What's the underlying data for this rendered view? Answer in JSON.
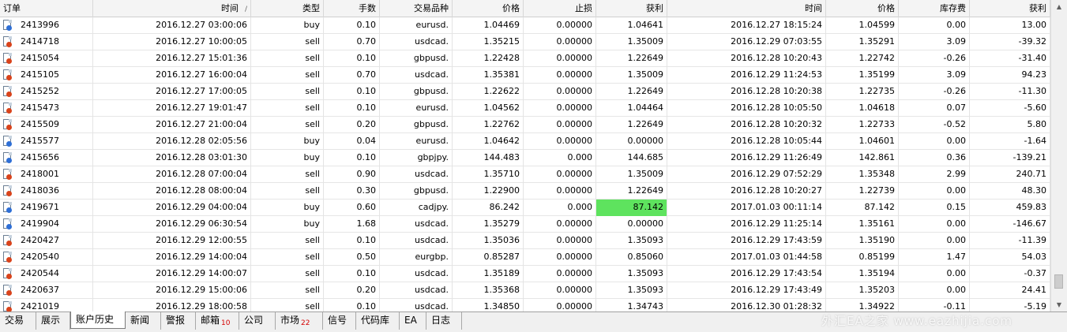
{
  "columns": [
    {
      "key": "order",
      "label": "订单"
    },
    {
      "key": "open_time",
      "label": "时间",
      "sort": "/"
    },
    {
      "key": "type",
      "label": "类型"
    },
    {
      "key": "lots",
      "label": "手数"
    },
    {
      "key": "symbol",
      "label": "交易品种"
    },
    {
      "key": "open_price",
      "label": "价格"
    },
    {
      "key": "sl",
      "label": "止损"
    },
    {
      "key": "tp",
      "label": "获利"
    },
    {
      "key": "close_time",
      "label": "时间"
    },
    {
      "key": "close_price",
      "label": "价格"
    },
    {
      "key": "swap",
      "label": "库存费"
    },
    {
      "key": "profit",
      "label": "获利"
    }
  ],
  "rows": [
    [
      "2413996",
      "2016.12.27 03:00:06",
      "buy",
      "0.10",
      "eurusd.",
      "1.04469",
      "0.00000",
      "1.04641",
      "2016.12.27 18:15:24",
      "1.04599",
      "0.00",
      "13.00"
    ],
    [
      "2414718",
      "2016.12.27 10:00:05",
      "sell",
      "0.70",
      "usdcad.",
      "1.35215",
      "0.00000",
      "1.35009",
      "2016.12.29 07:03:55",
      "1.35291",
      "3.09",
      "-39.32"
    ],
    [
      "2415054",
      "2016.12.27 15:01:36",
      "sell",
      "0.10",
      "gbpusd.",
      "1.22428",
      "0.00000",
      "1.22649",
      "2016.12.28 10:20:43",
      "1.22742",
      "-0.26",
      "-31.40"
    ],
    [
      "2415105",
      "2016.12.27 16:00:04",
      "sell",
      "0.70",
      "usdcad.",
      "1.35381",
      "0.00000",
      "1.35009",
      "2016.12.29 11:24:53",
      "1.35199",
      "3.09",
      "94.23"
    ],
    [
      "2415252",
      "2016.12.27 17:00:05",
      "sell",
      "0.10",
      "gbpusd.",
      "1.22622",
      "0.00000",
      "1.22649",
      "2016.12.28 10:20:38",
      "1.22735",
      "-0.26",
      "-11.30"
    ],
    [
      "2415473",
      "2016.12.27 19:01:47",
      "sell",
      "0.10",
      "eurusd.",
      "1.04562",
      "0.00000",
      "1.04464",
      "2016.12.28 10:05:50",
      "1.04618",
      "0.07",
      "-5.60"
    ],
    [
      "2415509",
      "2016.12.27 21:00:04",
      "sell",
      "0.20",
      "gbpusd.",
      "1.22762",
      "0.00000",
      "1.22649",
      "2016.12.28 10:20:32",
      "1.22733",
      "-0.52",
      "5.80"
    ],
    [
      "2415577",
      "2016.12.28 02:05:56",
      "buy",
      "0.04",
      "eurusd.",
      "1.04642",
      "0.00000",
      "0.00000",
      "2016.12.28 10:05:44",
      "1.04601",
      "0.00",
      "-1.64"
    ],
    [
      "2415656",
      "2016.12.28 03:01:30",
      "buy",
      "0.10",
      "gbpjpy.",
      "144.483",
      "0.000",
      "144.685",
      "2016.12.29 11:26:49",
      "142.861",
      "0.36",
      "-139.21"
    ],
    [
      "2418001",
      "2016.12.28 07:00:04",
      "sell",
      "0.90",
      "usdcad.",
      "1.35710",
      "0.00000",
      "1.35009",
      "2016.12.29 07:52:29",
      "1.35348",
      "2.99",
      "240.71"
    ],
    [
      "2418036",
      "2016.12.28 08:00:04",
      "sell",
      "0.30",
      "gbpusd.",
      "1.22900",
      "0.00000",
      "1.22649",
      "2016.12.28 10:20:27",
      "1.22739",
      "0.00",
      "48.30"
    ],
    [
      "2419671",
      "2016.12.29 04:00:04",
      "buy",
      "0.60",
      "cadjpy.",
      "86.242",
      "0.000",
      "87.142",
      "2017.01.03 00:11:14",
      "87.142",
      "0.15",
      "459.83"
    ],
    [
      "2419904",
      "2016.12.29 06:30:54",
      "buy",
      "1.68",
      "usdcad.",
      "1.35279",
      "0.00000",
      "0.00000",
      "2016.12.29 11:25:14",
      "1.35161",
      "0.00",
      "-146.67"
    ],
    [
      "2420427",
      "2016.12.29 12:00:55",
      "sell",
      "0.10",
      "usdcad.",
      "1.35036",
      "0.00000",
      "1.35093",
      "2016.12.29 17:43:59",
      "1.35190",
      "0.00",
      "-11.39"
    ],
    [
      "2420540",
      "2016.12.29 14:00:04",
      "sell",
      "0.50",
      "eurgbp.",
      "0.85287",
      "0.00000",
      "0.85060",
      "2017.01.03 01:44:58",
      "0.85199",
      "1.47",
      "54.03"
    ],
    [
      "2420544",
      "2016.12.29 14:00:07",
      "sell",
      "0.10",
      "usdcad.",
      "1.35189",
      "0.00000",
      "1.35093",
      "2016.12.29 17:43:54",
      "1.35194",
      "0.00",
      "-0.37"
    ],
    [
      "2420637",
      "2016.12.29 15:00:06",
      "sell",
      "0.20",
      "usdcad.",
      "1.35368",
      "0.00000",
      "1.35093",
      "2016.12.29 17:43:49",
      "1.35203",
      "0.00",
      "24.41"
    ],
    [
      "2421019",
      "2016.12.29 18:00:58",
      "sell",
      "0.10",
      "usdcad.",
      "1.34850",
      "0.00000",
      "1.34743",
      "2016.12.30 01:28:32",
      "1.34922",
      "-0.11",
      "-5.19"
    ]
  ],
  "highlight": {
    "row": 11,
    "col": 7,
    "color": "#5ee35e"
  },
  "tabs": [
    {
      "label": "交易"
    },
    {
      "label": "展示"
    },
    {
      "label": "账户历史",
      "active": true
    },
    {
      "label": "新闻"
    },
    {
      "label": "警报"
    },
    {
      "label": "邮箱",
      "count": "10"
    },
    {
      "label": "公司"
    },
    {
      "label": "市场",
      "count": "22"
    },
    {
      "label": "信号"
    },
    {
      "label": "代码库"
    },
    {
      "label": "EA"
    },
    {
      "label": "日志"
    }
  ],
  "watermark": "外汇EA之家 www.eazhijia.com"
}
